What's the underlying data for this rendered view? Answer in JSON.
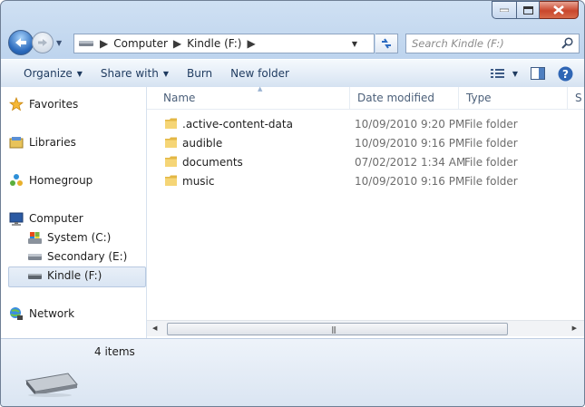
{
  "window": {
    "minimize_icon": "minimize-icon",
    "maximize_icon": "maximize-icon",
    "close_icon": "close-icon"
  },
  "address": {
    "segments": [
      "Computer",
      "Kindle (F:)"
    ]
  },
  "search": {
    "placeholder": "Search Kindle (F:)"
  },
  "toolbar": {
    "organize": "Organize",
    "share_with": "Share with",
    "burn": "Burn",
    "new_folder": "New folder"
  },
  "nav": {
    "favorites": "Favorites",
    "libraries": "Libraries",
    "homegroup": "Homegroup",
    "computer": "Computer",
    "system": "System (C:)",
    "secondary": "Secondary (E:)",
    "kindle": "Kindle (F:)",
    "network": "Network"
  },
  "columns": {
    "name": "Name",
    "date": "Date modified",
    "type": "Type",
    "size": "S"
  },
  "files": [
    {
      "name": ".active-content-data",
      "date": "10/09/2010 9:20 PM",
      "type": "File folder"
    },
    {
      "name": "audible",
      "date": "10/09/2010 9:16 PM",
      "type": "File folder"
    },
    {
      "name": "documents",
      "date": "07/02/2012 1:34 AM",
      "type": "File folder"
    },
    {
      "name": "music",
      "date": "10/09/2010 9:16 PM",
      "type": "File folder"
    }
  ],
  "details": {
    "count": "4 items"
  },
  "colors": {
    "accent": "#1e3a5f",
    "selection": "#d9e5f3",
    "close_red": "#c9462c"
  }
}
